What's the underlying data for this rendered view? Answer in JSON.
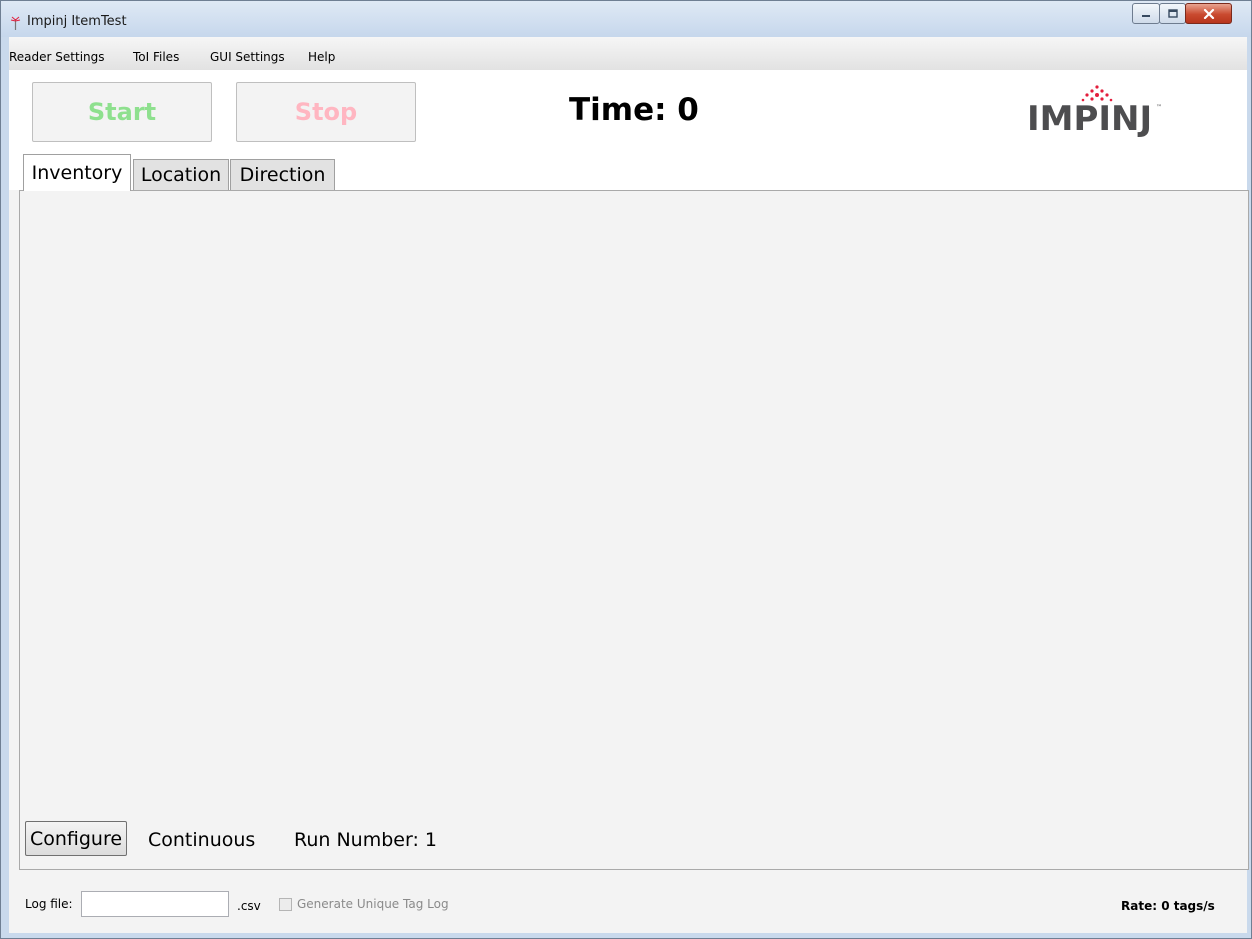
{
  "window": {
    "title": "Impinj ItemTest"
  },
  "menu": {
    "items": [
      "Reader Settings",
      "ToI Files",
      "GUI Settings",
      "Help"
    ]
  },
  "toolbar": {
    "start_label": "Start",
    "stop_label": "Stop",
    "time_label": "Time: 0",
    "logo_text": "IMPINJ",
    "start_color": "#8ee08e",
    "stop_color": "#ffb6c1"
  },
  "tabs": [
    {
      "label": "Inventory",
      "active": true
    },
    {
      "label": "Location",
      "active": false
    },
    {
      "label": "Direction",
      "active": false
    }
  ],
  "panel": {
    "configure_label": "Configure",
    "mode_text": "Continuous",
    "run_number_text": "Run Number: 1"
  },
  "status": {
    "log_file_label": "Log file:",
    "log_file_value": "",
    "csv_suffix": ".csv",
    "unique_log_label": "Generate Unique Tag Log",
    "unique_log_checked": false,
    "rate_text": "Rate: 0 tags/s"
  },
  "icons": {
    "app": "antenna-icon",
    "logo": "impinj-logo",
    "minimize": "minimize-icon",
    "maximize": "maximize-icon",
    "close": "close-icon"
  },
  "colors": {
    "logo_text": "#4d4d4f",
    "logo_dots": "#e31e3c",
    "window_close": "#c94a2f"
  }
}
